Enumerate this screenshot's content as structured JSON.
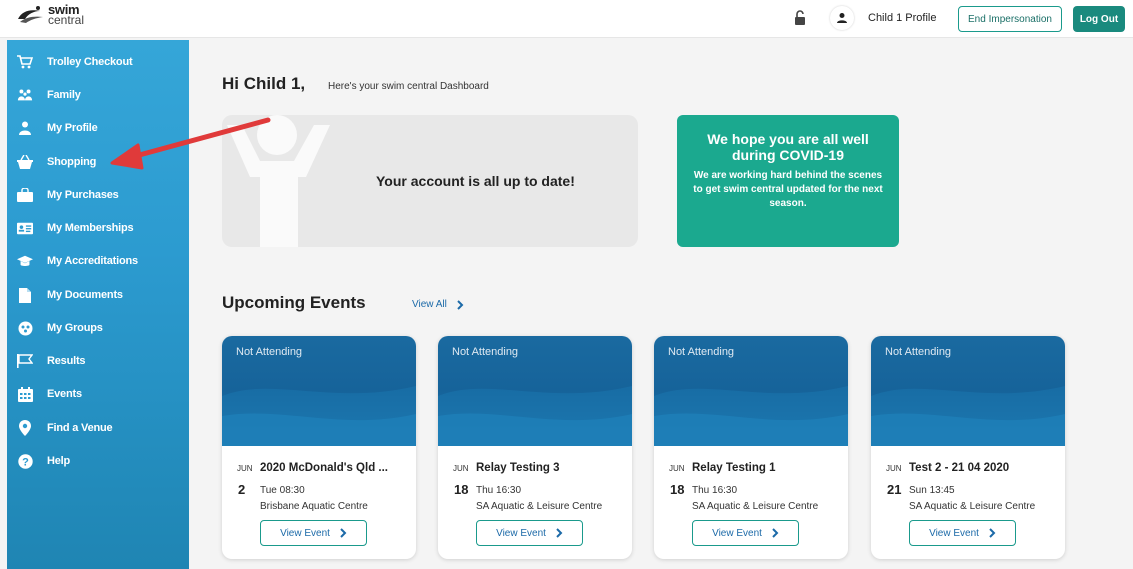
{
  "header": {
    "logo_line1": "swim",
    "logo_line2": "central",
    "profile_name": "Child 1 Profile",
    "end_impersonation_label": "End Impersonation",
    "logout_label": "Log Out",
    "icons": [
      "lock-icon",
      "user-icon"
    ]
  },
  "sidebar": {
    "items": [
      {
        "label": "Trolley Checkout",
        "icon": "cart-icon"
      },
      {
        "label": "Family",
        "icon": "family-icon"
      },
      {
        "label": "My Profile",
        "icon": "person-icon"
      },
      {
        "label": "Shopping",
        "icon": "basket-icon"
      },
      {
        "label": "My Purchases",
        "icon": "bag-icon"
      },
      {
        "label": "My Memberships",
        "icon": "id-card-icon"
      },
      {
        "label": "My Accreditations",
        "icon": "graduation-cap-icon"
      },
      {
        "label": "My Documents",
        "icon": "document-icon"
      },
      {
        "label": "My Groups",
        "icon": "groups-icon"
      },
      {
        "label": "Results",
        "icon": "flag-icon"
      },
      {
        "label": "Events",
        "icon": "calendar-icon"
      },
      {
        "label": "Find a Venue",
        "icon": "location-pin-icon"
      },
      {
        "label": "Help",
        "icon": "help-icon"
      }
    ]
  },
  "main": {
    "greeting": "Hi Child 1,",
    "greeting_sub": "Here's your swim central Dashboard",
    "status_message": "Your account is all up to date!",
    "covid": {
      "title": "We hope you are all well during COVID-19",
      "body": "We are working hard behind the scenes to get swim central updated for the next season."
    },
    "events_heading": "Upcoming Events",
    "view_all_label": "View All",
    "events": [
      {
        "status": "Not Attending",
        "month": "JUN",
        "day": "2",
        "title": "2020 McDonald's Qld ...",
        "time": "Tue 08:30",
        "venue": "Brisbane Aquatic Centre",
        "button": "View Event"
      },
      {
        "status": "Not Attending",
        "month": "JUN",
        "day": "18",
        "title": "Relay Testing 3",
        "time": "Thu 16:30",
        "venue": "SA Aquatic & Leisure Centre",
        "button": "View Event"
      },
      {
        "status": "Not Attending",
        "month": "JUN",
        "day": "18",
        "title": "Relay Testing 1",
        "time": "Thu 16:30",
        "venue": "SA Aquatic & Leisure Centre",
        "button": "View Event"
      },
      {
        "status": "Not Attending",
        "month": "JUN",
        "day": "21",
        "title": "Test 2 - 21 04 2020",
        "time": "Sun 13:45",
        "venue": "SA Aquatic & Leisure Centre",
        "button": "View Event"
      }
    ]
  },
  "colors": {
    "sidebar": "#2c9bd0",
    "accent_teal": "#1a8a7e",
    "covid_card": "#1ba98f",
    "event_banner": "#16639a",
    "annotation_arrow": "#e03a3a"
  }
}
